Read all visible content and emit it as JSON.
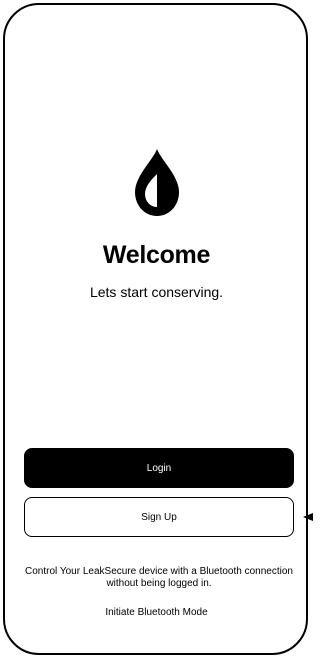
{
  "welcome": {
    "title": "Welcome",
    "subtitle": "Lets start conserving."
  },
  "logo": {
    "icon": "water-drop-icon"
  },
  "actions": {
    "login_label": "Login",
    "signup_label": "Sign Up"
  },
  "bluetooth": {
    "info_text": "Control Your LeakSecure device with a Bluetooth connection without being logged in.",
    "link_label": "Initiate Bluetooth Mode"
  },
  "colors": {
    "primary": "#000000",
    "background": "#ffffff"
  }
}
